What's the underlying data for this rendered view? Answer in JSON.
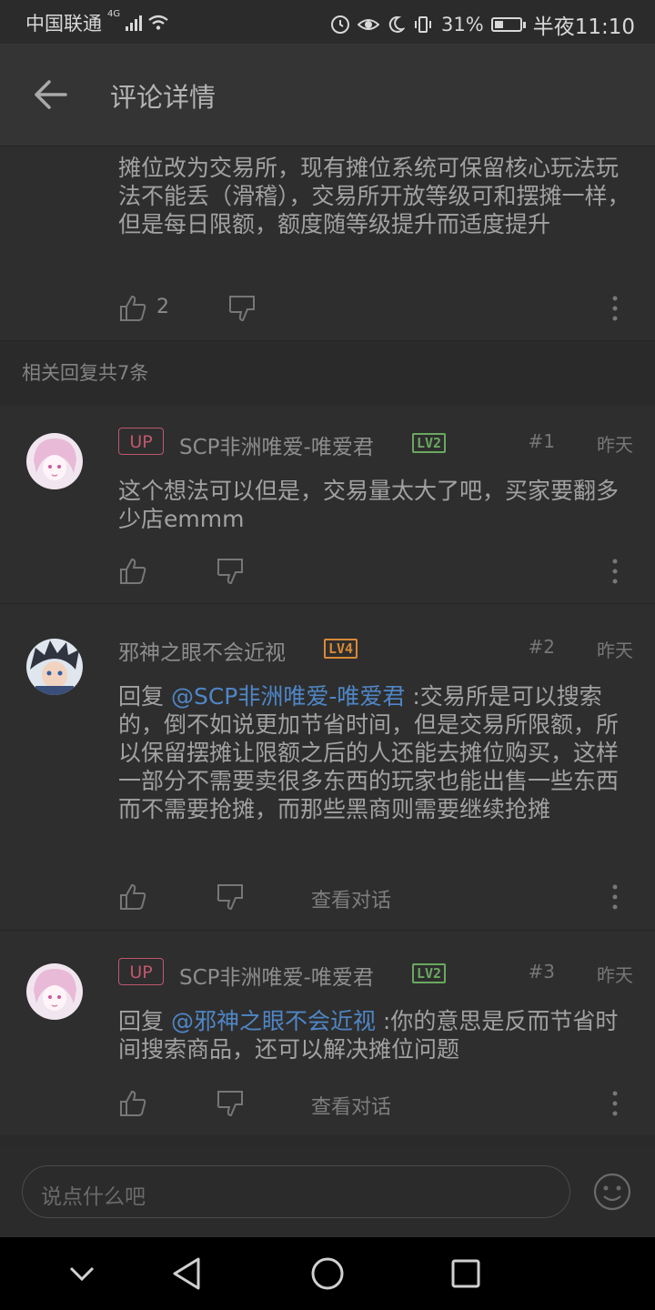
{
  "status_bar": {
    "carrier": "中国联通",
    "network": "4G",
    "battery": "31%",
    "time": "半夜11:10"
  },
  "header": {
    "title": "评论详情"
  },
  "main_comment": {
    "text": "摊位改为交易所，现有摊位系统可保留核心玩法玩法不能丢（滑稽），交易所开放等级可和摆摊一样，但是每日限额，额度随等级提升而适度提升",
    "likes": "2"
  },
  "related_label": "相关回复共7条",
  "replies": [
    {
      "up_badge": "UP",
      "username": "SCP非洲唯爱-唯爱君",
      "level": "LV2",
      "floor": "#1",
      "time": "昨天",
      "prefix": "",
      "mention": "",
      "text": "这个想法可以但是，交易量太大了吧，买家要翻多少店emmm"
    },
    {
      "up_badge": "",
      "username": "邪神之眼不会近视",
      "level": "LV4",
      "floor": "#2",
      "time": "昨天",
      "prefix": "回复 ",
      "mention": "@SCP非洲唯爱-唯爱君",
      "text": " :交易所是可以搜索的，倒不如说更加节省时间，但是交易所限额，所以保留摆摊让限额之后的人还能去摊位购买，这样一部分不需要卖很多东西的玩家也能出售一些东西而不需要抢摊，而那些黑商则需要继续抢摊",
      "view_conversation": "查看对话"
    },
    {
      "up_badge": "UP",
      "username": "SCP非洲唯爱-唯爱君",
      "level": "LV2",
      "floor": "#3",
      "time": "昨天",
      "prefix": "回复 ",
      "mention": "@邪神之眼不会近视",
      "text": " :你的意思是反而节省时间搜索商品，还可以解决摊位问题",
      "view_conversation": "查看对话"
    }
  ],
  "input": {
    "placeholder": "说点什么吧"
  },
  "colors": {
    "background": "#2a2a2a",
    "card": "#2e2e2e",
    "mention": "#4f86c6",
    "up_badge": "#c0576f",
    "lv2": "#6aa860",
    "lv4": "#d88a36"
  }
}
